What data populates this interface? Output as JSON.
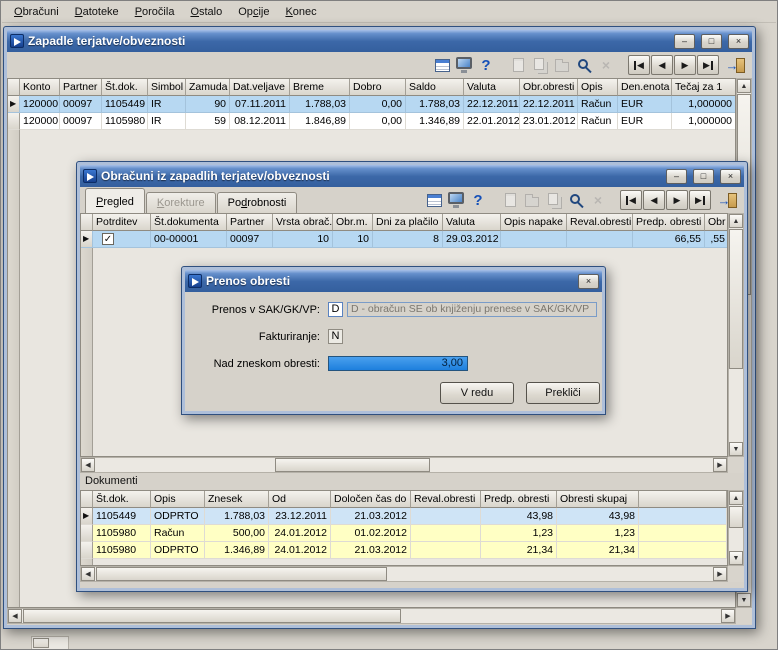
{
  "colors": {
    "titlebar_blue": "#3c68a8",
    "selection_blue": "#b7d8f2",
    "row_yellow": "#ffffc4",
    "row_lightblue": "#cfe4f6",
    "accent_blue": "#1550b8",
    "input_selection_blue": "#2e90ea"
  },
  "icons": {
    "minimize": "–",
    "maximize": "□",
    "close": "×",
    "help": "?",
    "delete": "×",
    "check": "✓",
    "row_marker": "▶",
    "left": "◀",
    "right": "▶",
    "up": "▲",
    "down": "▼",
    "nav_first": "◀",
    "nav_prev": "◀",
    "nav_next": "▶",
    "nav_last": "▶",
    "exit_arrow": "→"
  },
  "menu": {
    "items": [
      {
        "pre": "",
        "key": "O",
        "post": "bračuni"
      },
      {
        "pre": "",
        "key": "D",
        "post": "atoteke"
      },
      {
        "pre": "",
        "key": "P",
        "post": "oročila"
      },
      {
        "pre": "",
        "key": "O",
        "post": "stalo"
      },
      {
        "pre": "Op",
        "key": "c",
        "post": "ije"
      },
      {
        "pre": "",
        "key": "K",
        "post": "onec"
      }
    ]
  },
  "window_main": {
    "title": "Zapadle terjatve/obveznosti",
    "grid": {
      "columns": [
        "Konto",
        "Partner",
        "Št.dok.",
        "Simbol",
        "Zamuda",
        "Dat.veljave",
        "Breme",
        "Dobro",
        "Saldo",
        "Valuta",
        "Obr.obresti",
        "Opis",
        "Den.enota",
        "Tečaj za 1"
      ],
      "rows": [
        [
          "120000",
          "00097",
          "1105449",
          "IR",
          "90",
          "07.11.2011",
          "1.788,03",
          "0,00",
          "1.788,03",
          "22.12.2011",
          "22.12.2011",
          "Račun",
          "EUR",
          "1,000000"
        ],
        [
          "120000",
          "00097",
          "1105980",
          "IR",
          "59",
          "08.12.2011",
          "1.846,89",
          "0,00",
          "1.346,89",
          "22.01.2012",
          "23.01.2012",
          "Račun",
          "EUR",
          "1,000000"
        ]
      ]
    }
  },
  "window_calc": {
    "title": "Obračuni iz zapadlih terjatev/obveznosti",
    "tabs": [
      {
        "pre": "",
        "key": "P",
        "post": "regled"
      },
      {
        "pre": "",
        "key": "K",
        "post": "orekture"
      },
      {
        "pre": "Po",
        "key": "d",
        "post": "robnosti"
      }
    ],
    "grid": {
      "columns": [
        "Potrditev",
        "Št.dokumenta",
        "Partner",
        "Vrsta obrač.",
        "Obr.m.",
        "Dni za plačilo",
        "Valuta",
        "Opis napake",
        "Reval.obresti",
        "Predp. obresti",
        "Obr"
      ],
      "row": {
        "checked": true,
        "cells": [
          "00-00001",
          "00097",
          "10",
          "10",
          "8",
          "29.03.2012",
          "",
          "",
          "66,55",
          ",55"
        ]
      }
    },
    "dokumenti": {
      "label": "Dokumenti",
      "columns": [
        "Št.dok.",
        "Opis",
        "Znesek",
        "Od",
        "Določen čas do",
        "Reval.obresti",
        "Predp. obresti",
        "Obresti skupaj"
      ],
      "rows": [
        [
          "1105449",
          "ODPRTO",
          "1.788,03",
          "23.12.2011",
          "21.03.2012",
          "",
          "43,98",
          "43,98"
        ],
        [
          "1105980",
          "Račun",
          "500,00",
          "24.01.2012",
          "01.02.2012",
          "",
          "1,23",
          "1,23"
        ],
        [
          "1105980",
          "ODPRTO",
          "1.346,89",
          "24.01.2012",
          "21.03.2012",
          "",
          "21,34",
          "21,34"
        ]
      ]
    }
  },
  "dialog": {
    "title": "Prenos obresti",
    "fields": [
      {
        "label": "Prenos v SAK/GK/VP:",
        "value": "D",
        "desc": "D - obračun SE ob knjiženju prenese v SAK/GK/VP"
      },
      {
        "label": "Fakturiranje:",
        "value": "N"
      },
      {
        "label": "Nad zneskom obresti:",
        "value": "3,00"
      }
    ],
    "buttons": {
      "ok": "V redu",
      "cancel": "Prekliči"
    }
  }
}
